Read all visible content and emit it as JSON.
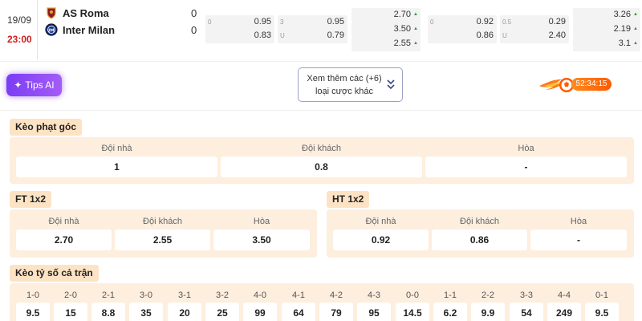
{
  "match": {
    "date": "19/09",
    "time": "23:00",
    "home": {
      "name": "AS Roma",
      "score": "0"
    },
    "away": {
      "name": "Inter Milan",
      "score": "0"
    }
  },
  "odds": {
    "ft_handicap": {
      "line1": "0",
      "home": "0.95",
      "line2": "",
      "away": "0.83"
    },
    "ft_ou": {
      "line1": "3",
      "over": "0.95",
      "line2": "U",
      "under": "0.79"
    },
    "ft_1x2": [
      "2.70",
      "3.50",
      "2.55"
    ],
    "ht_handicap": {
      "line1": "0",
      "home": "0.92",
      "line2": "",
      "away": "0.86"
    },
    "ht_ou": {
      "line1": "0.5",
      "over": "0.29",
      "line2": "U",
      "under": "2.40"
    },
    "ht_1x2": [
      "3.26",
      "2.19",
      "3.1"
    ]
  },
  "actions": {
    "tips_label": "Tips AI",
    "more_line1": "Xem thêm các (+6)",
    "more_line2": "loại cược khác",
    "live_timer": "52:34:15"
  },
  "corner": {
    "title": "Kèo phạt góc",
    "labels": [
      "Đội nhà",
      "Đội khách",
      "Hòa"
    ],
    "values": [
      "1",
      "0.8",
      "-"
    ]
  },
  "ft1x2": {
    "title": "FT 1x2",
    "labels": [
      "Đội nhà",
      "Đội khách",
      "Hòa"
    ],
    "values": [
      "2.70",
      "2.55",
      "3.50"
    ]
  },
  "ht1x2": {
    "title": "HT 1x2",
    "labels": [
      "Đội nhà",
      "Đội khách",
      "Hòa"
    ],
    "values": [
      "0.92",
      "0.86",
      "-"
    ]
  },
  "correct_score": {
    "title": "Kèo tỷ số cả trận",
    "labels": [
      "1-0",
      "2-0",
      "2-1",
      "3-0",
      "3-1",
      "3-2",
      "4-0",
      "4-1",
      "4-2",
      "4-3",
      "0-0",
      "1-1",
      "2-2",
      "3-3",
      "4-4",
      "0-1"
    ],
    "values": [
      "9.5",
      "15",
      "8.8",
      "35",
      "20",
      "25",
      "99",
      "64",
      "79",
      "95",
      "14.5",
      "6.2",
      "9.9",
      "54",
      "249",
      "9.5"
    ]
  },
  "colors": {
    "time": "#d21d1d",
    "section_bg": "#fdeede",
    "section_title_bg": "#fde3c4",
    "tips_gradient": "#7b3df3",
    "up_arrow": "#2a9d3b"
  }
}
